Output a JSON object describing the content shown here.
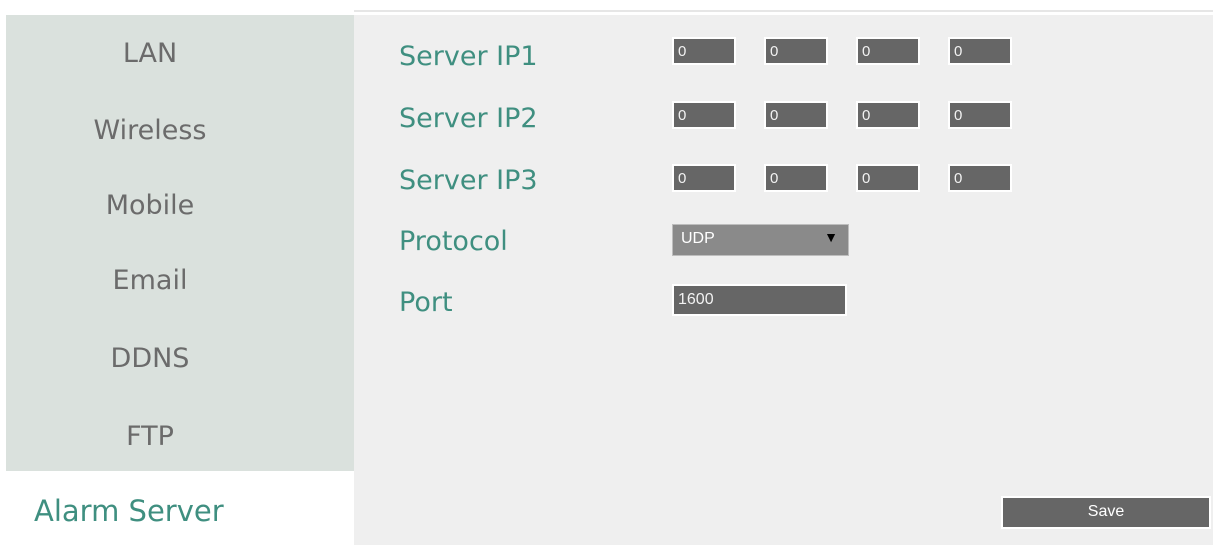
{
  "sidebar": {
    "items": [
      {
        "label": "LAN"
      },
      {
        "label": "Wireless"
      },
      {
        "label": "Mobile"
      },
      {
        "label": "Email"
      },
      {
        "label": "DDNS"
      },
      {
        "label": "FTP"
      }
    ],
    "active_label": "Alarm Server"
  },
  "form": {
    "server_ip1": {
      "label": "Server IP1",
      "octets": [
        "0",
        "0",
        "0",
        "0"
      ]
    },
    "server_ip2": {
      "label": "Server IP2",
      "octets": [
        "0",
        "0",
        "0",
        "0"
      ]
    },
    "server_ip3": {
      "label": "Server IP3",
      "octets": [
        "0",
        "0",
        "0",
        "0"
      ]
    },
    "protocol": {
      "label": "Protocol",
      "value": "UDP"
    },
    "port": {
      "label": "Port",
      "value": "1600"
    },
    "save_label": "Save"
  },
  "colors": {
    "accent": "#3f8f80",
    "sidebar_bg": "#dae1dd",
    "field_bg": "#666666"
  }
}
